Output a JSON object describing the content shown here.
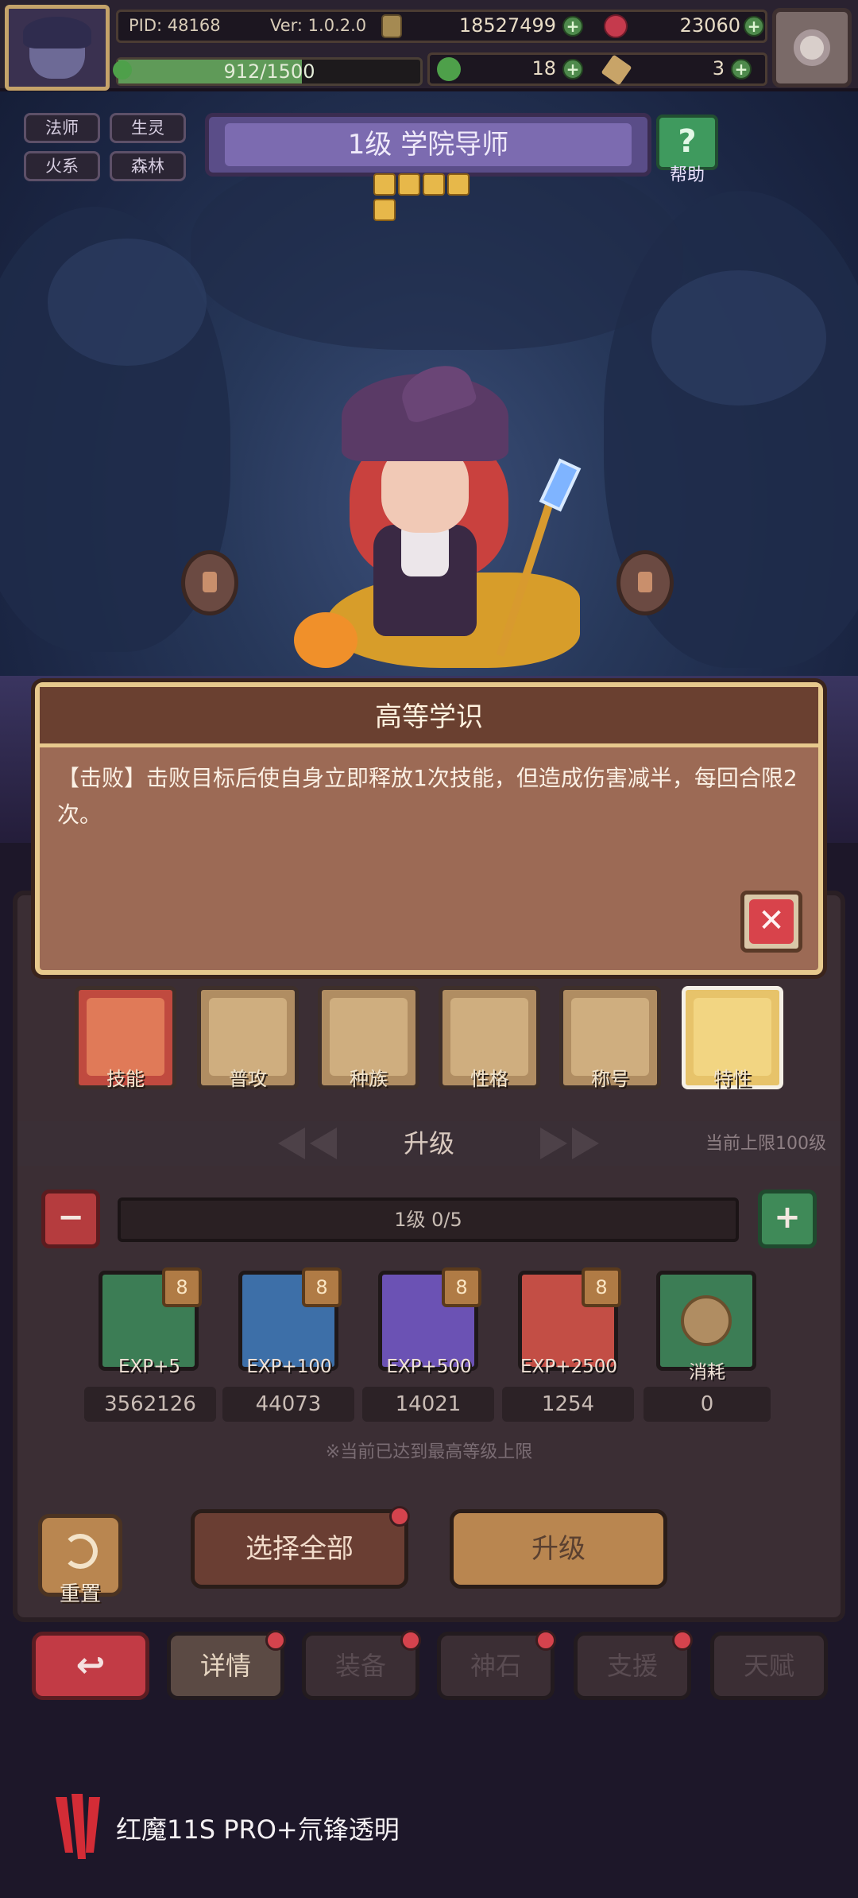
{
  "header": {
    "pid": "PID: 48168",
    "version": "Ver: 1.0.2.0",
    "gold": "18527499",
    "gems": "23060",
    "exp_text": "912/1500",
    "exp_fraction": 0.608,
    "clover": "18",
    "keys": "3",
    "plus": "+"
  },
  "hero": {
    "tags": [
      "法师",
      "生灵",
      "火系",
      "森林"
    ],
    "title": "1级  学院导师",
    "stars": 5,
    "help_label": "帮助",
    "help_glyph": "?"
  },
  "modal": {
    "title": "高等学识",
    "body": "【击败】击败目标后使自身立即释放1次技能，但造成伤害减半，每回合限2次。",
    "close_glyph": "✕"
  },
  "tabs": [
    {
      "label": "技能",
      "color": "#c04a3f"
    },
    {
      "label": "普攻",
      "color": "#b08d62"
    },
    {
      "label": "种族",
      "color": "#b08d62"
    },
    {
      "label": "性格",
      "color": "#b08d62"
    },
    {
      "label": "称号",
      "color": "#b08d62"
    },
    {
      "label": "特性",
      "color": "#e7c36a"
    }
  ],
  "upgrade": {
    "title": "升级",
    "limit": "当前上限100级",
    "level_progress": "1级  0/5",
    "minus_glyph": "−",
    "plus_glyph": "+",
    "items": [
      {
        "label": "EXP+5",
        "count": "3562126",
        "badge": "8",
        "color": "#3c7d55"
      },
      {
        "label": "EXP+100",
        "count": "44073",
        "badge": "8",
        "color": "#3d6fa8"
      },
      {
        "label": "EXP+500",
        "count": "14021",
        "badge": "8",
        "color": "#6b52b4"
      },
      {
        "label": "EXP+2500",
        "count": "1254",
        "badge": "8",
        "color": "#c34e45"
      },
      {
        "label": "消耗",
        "count": "0",
        "badge": "",
        "color": "#3c7d55"
      }
    ],
    "note": "※当前已达到最高等级上限"
  },
  "actions": {
    "reset_label": "重置",
    "select_all": "选择全部",
    "upgrade": "升级"
  },
  "nav": {
    "back_glyph": "↩",
    "items": [
      "详情",
      "装备",
      "神石",
      "支援",
      "天赋"
    ]
  },
  "brand": {
    "text": "红魔11S PRO+氘锋透明"
  }
}
